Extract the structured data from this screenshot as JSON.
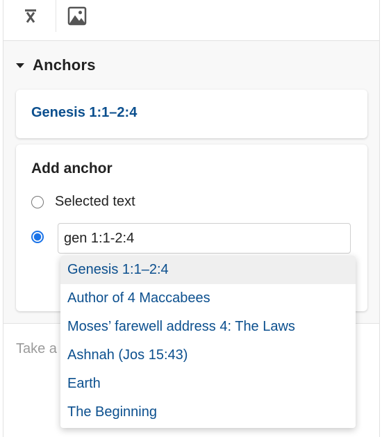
{
  "toolbar": {
    "buttons": [
      {
        "icon": "clear-formatting-icon"
      },
      {
        "icon": "image-icon"
      }
    ]
  },
  "anchors_section": {
    "title": "Anchors",
    "expanded": true,
    "anchors": [
      {
        "label": "Genesis 1:1–2:4"
      }
    ]
  },
  "add_anchor": {
    "title": "Add anchor",
    "options": [
      {
        "label": "Selected text",
        "checked": false
      },
      {
        "label": "",
        "checked": true
      }
    ],
    "input": {
      "value": "gen 1:1-2:4"
    }
  },
  "notes": {
    "placeholder_visible": "Take a"
  },
  "suggestions": [
    {
      "label": "Genesis 1:1–2:4",
      "highlighted": true
    },
    {
      "label": "Author of 4 Maccabees",
      "highlighted": false
    },
    {
      "label": "Moses’ farewell address 4: The Laws",
      "highlighted": false
    },
    {
      "label": "Ashnah (Jos 15:43)",
      "highlighted": false
    },
    {
      "label": "Earth",
      "highlighted": false
    },
    {
      "label": "The Beginning",
      "highlighted": false
    }
  ],
  "colors": {
    "link": "#0b4f8e",
    "radio_accent": "#1a73e8",
    "panel_bg": "#f8f8f8"
  }
}
